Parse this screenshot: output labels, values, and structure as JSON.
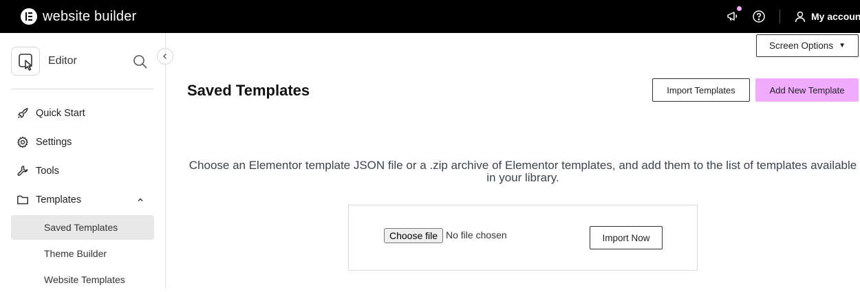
{
  "topbar": {
    "brand": "website builder",
    "account_label": "My account",
    "icons": [
      "elementor-logo-icon",
      "megaphone-icon",
      "help-icon",
      "user-icon"
    ],
    "notification_color": "#f0abfc"
  },
  "sidebar": {
    "editor_label": "Editor",
    "items": [
      {
        "label": "Quick Start",
        "icon": "rocket-icon"
      },
      {
        "label": "Settings",
        "icon": "gear-icon"
      },
      {
        "label": "Tools",
        "icon": "wrench-icon"
      },
      {
        "label": "Templates",
        "icon": "folder-icon"
      }
    ],
    "subitems": [
      {
        "label": "Saved Templates",
        "active": true
      },
      {
        "label": "Theme Builder",
        "active": false
      },
      {
        "label": "Website Templates",
        "active": false
      }
    ]
  },
  "main": {
    "screen_options": "Screen Options",
    "title": "Saved Templates",
    "import_templates": "Import Templates",
    "add_new_template": "Add New Template",
    "import_description": "Choose an Elementor template JSON file or a .zip archive of Elementor templates, and add them to the list of templates available in your library.",
    "choose_file": "Choose file",
    "no_file": "No file chosen",
    "import_now": "Import Now"
  },
  "colors": {
    "accent": "#f0abfc",
    "topbar_bg": "#000000",
    "active_item_bg": "#e8e8e8"
  }
}
